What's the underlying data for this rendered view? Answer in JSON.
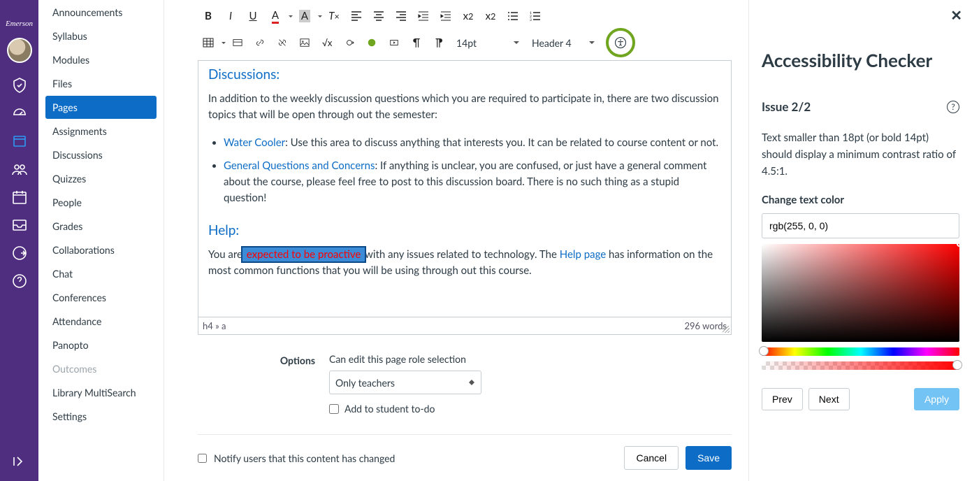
{
  "brand": "Emerson",
  "coursenav": {
    "items": [
      {
        "label": "Announcements"
      },
      {
        "label": "Syllabus"
      },
      {
        "label": "Modules"
      },
      {
        "label": "Files"
      },
      {
        "label": "Pages",
        "active": true
      },
      {
        "label": "Assignments"
      },
      {
        "label": "Discussions"
      },
      {
        "label": "Quizzes"
      },
      {
        "label": "People"
      },
      {
        "label": "Grades"
      },
      {
        "label": "Collaborations"
      },
      {
        "label": "Chat"
      },
      {
        "label": "Conferences"
      },
      {
        "label": "Attendance"
      },
      {
        "label": "Panopto"
      },
      {
        "label": "Outcomes",
        "muted": true
      },
      {
        "label": "Library MultiSearch"
      },
      {
        "label": "Settings"
      }
    ]
  },
  "toolbar": {
    "font_size": "14pt",
    "block_format": "Header 4"
  },
  "content": {
    "h1": "Discussions:",
    "p1": "In addition to the weekly discussion questions which you are required to participate in, there are two discussion topics that will be open through out the semester:",
    "li1_link": "Water Cooler",
    "li1_rest": ": Use this area to discuss anything that interests you. It can be related to course content or not.",
    "li2_link": "General Questions and Concerns",
    "li2_rest": ": If anything is unclear, you are confused, or just have a general comment about the course, please feel free to post to this discussion board. There is no such thing as a stupid question!",
    "h2": "Help:",
    "p2_pre": "You are",
    "p2_hl": " expected to be proactive ",
    "p2_mid": "with any issues related to technology. The ",
    "p2_link": "Help page",
    "p2_post": " has information on the most common functions that you will be using through out this course."
  },
  "status": {
    "path": "h4 » a",
    "words": "296 words"
  },
  "options": {
    "label": "Options",
    "role_label": "Can edit this page role selection",
    "role_value": "Only teachers",
    "todo_label": "Add to student to-do"
  },
  "footer": {
    "notify": "Notify users that this content has changed",
    "cancel": "Cancel",
    "save": "Save"
  },
  "panel": {
    "title": "Accessibility Checker",
    "issue": "Issue 2/2",
    "message": "Text smaller than 18pt (or bold 14pt) should display a minimum contrast ratio of 4.5:1.",
    "color_label": "Change text color",
    "color_value": "rgb(255, 0, 0)",
    "prev": "Prev",
    "next": "Next",
    "apply": "Apply"
  }
}
